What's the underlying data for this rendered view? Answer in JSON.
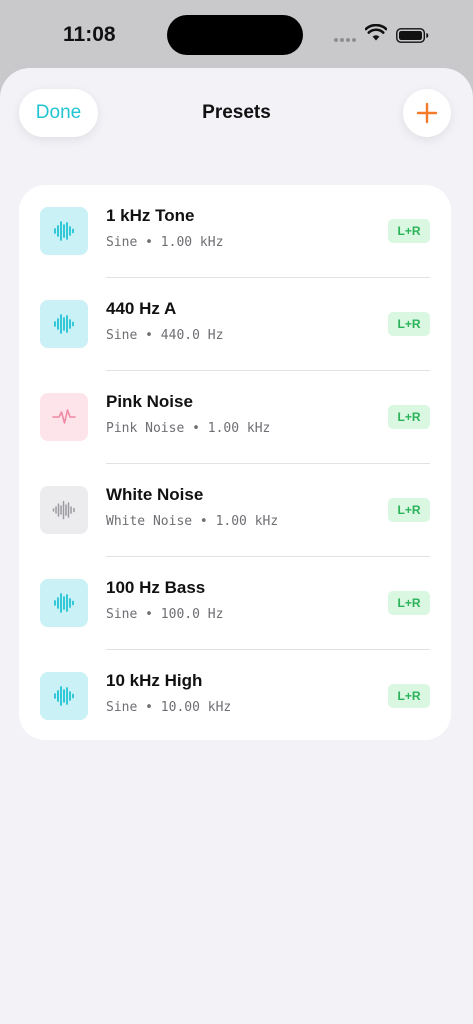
{
  "status_bar": {
    "time": "11:08"
  },
  "header": {
    "done_label": "Done",
    "title": "Presets",
    "add_label": "+"
  },
  "colors": {
    "accent_teal": "#22c4d4",
    "accent_orange": "#f47a2a",
    "badge_green": "#2bb35a",
    "pink": "#f08aa3",
    "gray": "#9a9aa0"
  },
  "presets": [
    {
      "title": "1 kHz Tone",
      "waveform": "Sine",
      "frequency": "1.00 kHz",
      "channel": "L+R",
      "icon": "waveform-icon"
    },
    {
      "title": "440 Hz A",
      "waveform": "Sine",
      "frequency": "440.0 Hz",
      "channel": "L+R",
      "icon": "waveform-icon"
    },
    {
      "title": "Pink Noise",
      "waveform": "Pink Noise",
      "frequency": "1.00 kHz",
      "channel": "L+R",
      "icon": "pulse-icon"
    },
    {
      "title": "White Noise",
      "waveform": "White Noise",
      "frequency": "1.00 kHz",
      "channel": "L+R",
      "icon": "noise-waveform-icon"
    },
    {
      "title": "100 Hz Bass",
      "waveform": "Sine",
      "frequency": "100.0 Hz",
      "channel": "L+R",
      "icon": "waveform-icon"
    },
    {
      "title": "10 kHz High",
      "waveform": "Sine",
      "frequency": "10.00 kHz",
      "channel": "L+R",
      "icon": "waveform-icon"
    }
  ]
}
